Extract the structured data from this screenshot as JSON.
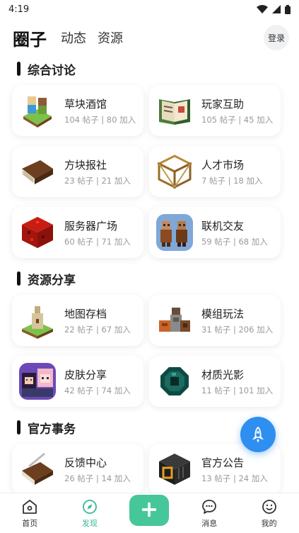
{
  "status": {
    "time": "4:19"
  },
  "header": {
    "tabs": [
      {
        "label": "圈子",
        "active": true
      },
      {
        "label": "动态",
        "active": false
      },
      {
        "label": "资源",
        "active": false
      }
    ],
    "login": "登录"
  },
  "sections": [
    {
      "title": "综合讨论",
      "items": [
        {
          "name": "草块酒馆",
          "meta": "104 帖子 | 80 加入",
          "icon": "grass-tavern-icon"
        },
        {
          "name": "玩家互助",
          "meta": "105 帖子 | 45 加入",
          "icon": "book-icon"
        },
        {
          "name": "方块报社",
          "meta": "23 帖子 | 21 加入",
          "icon": "brown-book-icon"
        },
        {
          "name": "人才市场",
          "meta": "7 帖子 | 18 加入",
          "icon": "scaffold-icon"
        },
        {
          "name": "服务器广场",
          "meta": "60 帖子 | 71 加入",
          "icon": "redstone-block-icon"
        },
        {
          "name": "联机交友",
          "meta": "59 帖子 | 68 加入",
          "icon": "villagers-icon"
        }
      ]
    },
    {
      "title": "资源分享",
      "items": [
        {
          "name": "地图存档",
          "meta": "22 帖子 | 67 加入",
          "icon": "map-island-icon"
        },
        {
          "name": "模组玩法",
          "meta": "31 帖子 | 206 加入",
          "icon": "mod-blocks-icon"
        },
        {
          "name": "皮肤分享",
          "meta": "42 帖子 | 74 加入",
          "icon": "skin-avatar-icon"
        },
        {
          "name": "材质光影",
          "meta": "11 帖子 | 101 加入",
          "icon": "ender-pearl-icon"
        }
      ]
    },
    {
      "title": "官方事务",
      "items": [
        {
          "name": "反馈中心",
          "meta": "26 帖子 | 14 加入",
          "icon": "feedback-book-icon"
        },
        {
          "name": "官方公告",
          "meta": "13 帖子 | 24 加入",
          "icon": "announcement-block-icon"
        }
      ]
    }
  ],
  "nav": [
    {
      "label": "首页",
      "icon": "home-icon",
      "active": false
    },
    {
      "label": "发现",
      "icon": "discover-icon",
      "active": true
    },
    {
      "label": "",
      "icon": "plus-icon",
      "active": false
    },
    {
      "label": "消息",
      "icon": "message-icon",
      "active": false
    },
    {
      "label": "我的",
      "icon": "profile-icon",
      "active": false
    }
  ],
  "colors": {
    "accent": "#45c79a",
    "nav_active": "#3ab794",
    "fab": "#2f8ff0"
  }
}
